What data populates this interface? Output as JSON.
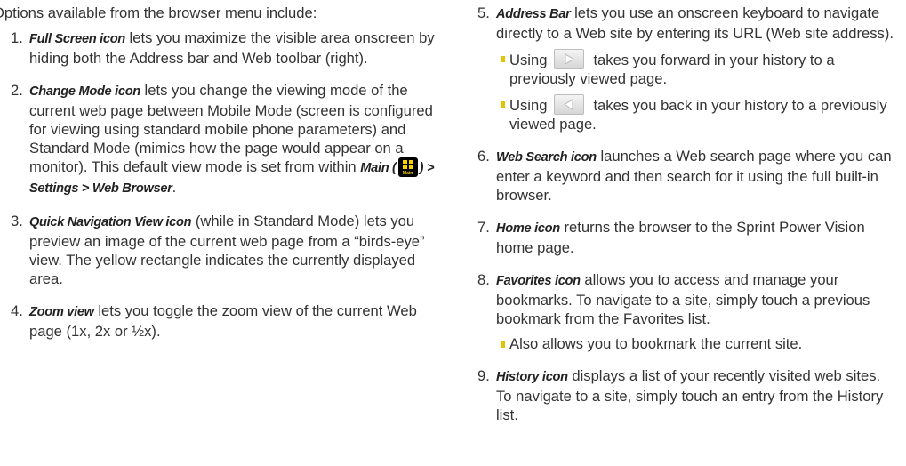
{
  "intro": "Options available from the browser menu include:",
  "icons": {
    "main_icon_label": "Main"
  },
  "left": [
    {
      "num": "1.",
      "term": "Full Screen icon",
      "text": " lets you maximize the visible area onscreen by hiding both the Address bar and Web toolbar (right)."
    },
    {
      "num": "2.",
      "term": "Change Mode icon",
      "text": " lets you change the viewing mode of the current web page between Mobile Mode (screen is configured for viewing using standard mobile phone parameters) and Standard Mode (mimics how the page would appear on a monitor). This default view mode is set from within ",
      "crumb_a": "Main (",
      "crumb_b": ") > Settings > Web Browser",
      "crumb_end": "."
    },
    {
      "num": "3.",
      "term": "Quick Navigation View icon",
      "text": " (while in Standard Mode) lets you preview an image of the current web page from a “birds-eye” view. The yellow rectangle indicates the currently displayed area."
    },
    {
      "num": "4.",
      "term": "Zoom view",
      "text": " lets you toggle the zoom view of the current Web page (1x, 2x or ½x)."
    }
  ],
  "right": [
    {
      "num": "5.",
      "term": "Address Bar",
      "text": " lets you use an onscreen keyboard to navigate directly to a Web site by entering its URL (Web site address).",
      "sub": [
        {
          "pre": "Using",
          "post": "takes you forward in your history to a previously viewed page."
        },
        {
          "pre": "Using",
          "post": "takes you back in your history to a previously viewed page."
        }
      ]
    },
    {
      "num": "6.",
      "term": "Web Search icon",
      "text": " launches a Web search page where you can enter a keyword and then search for it using the full built-in browser."
    },
    {
      "num": "7.",
      "term": "Home icon",
      "text": " returns the browser to the Sprint Power Vision home page."
    },
    {
      "num": "8.",
      "term": "Favorites icon",
      "text": " allows you to access and manage your bookmarks. To navigate to a site, simply touch a previous bookmark from the Favorites list.",
      "sub": [
        {
          "text": "Also allows you to bookmark the current site."
        }
      ]
    },
    {
      "num": "9.",
      "term": "History icon",
      "text": " displays a list of your recently visited web sites. To navigate to a site, simply touch an entry from the History list."
    }
  ]
}
